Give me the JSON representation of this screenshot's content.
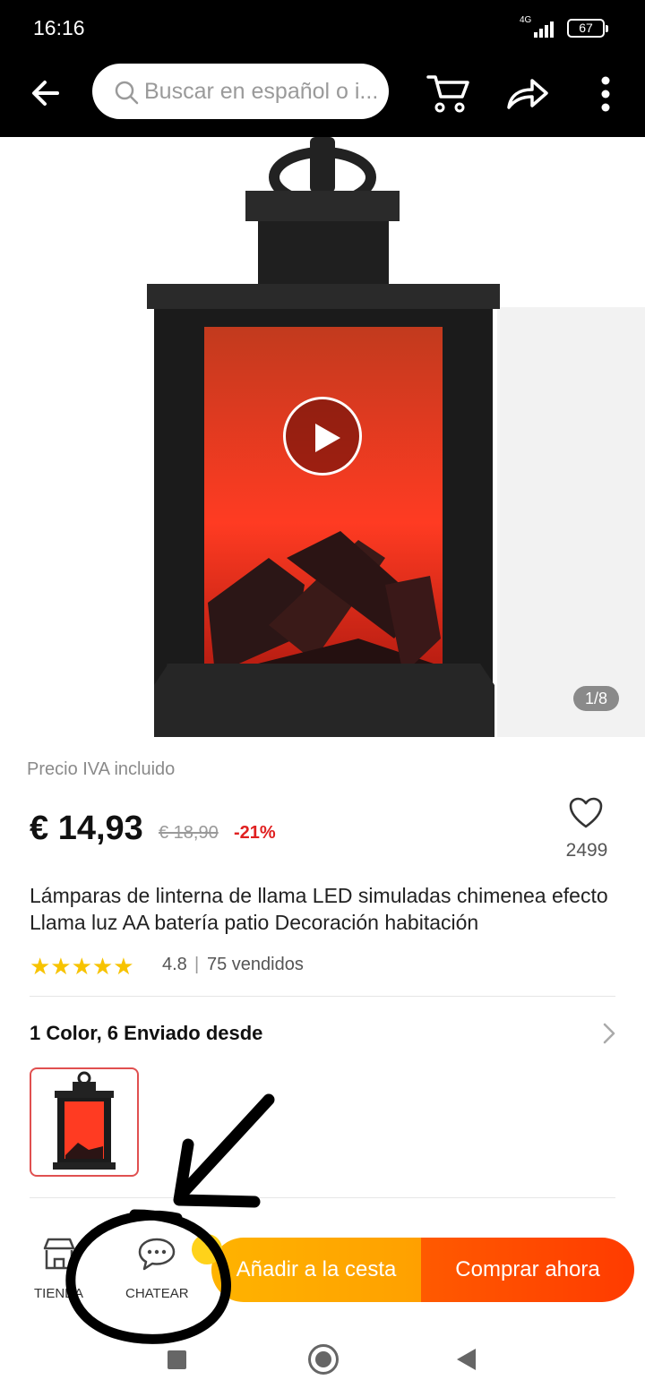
{
  "status_bar": {
    "time": "16:16",
    "network": "4G",
    "battery": "67"
  },
  "search": {
    "placeholder": "Buscar en español o i..."
  },
  "gallery": {
    "counter": "1/8"
  },
  "product": {
    "vat_note": "Precio IVA incluido",
    "price": "€ 14,93",
    "old_price": "€ 18,90",
    "discount": "-21%",
    "wishlist_count": "2499",
    "title": "Lámparas de linterna de llama LED simuladas chimenea efecto Llama luz AA batería patio Decoración habitación",
    "rating_stars": "★★★★★",
    "rating": "4.8",
    "rating_separator": "|",
    "sold": "75 vendidos"
  },
  "variants": {
    "title": "1 Color, 6 Enviado desde"
  },
  "bottom_bar": {
    "store_label": "TIENDA",
    "chat_label": "CHATEAR",
    "add_to_cart": "Añadir a la cesta",
    "buy_now": "Comprar ahora"
  },
  "colors": {
    "header_bg": "#000000",
    "add_to_cart": "#ffa500",
    "buy_now": "#ff4b00",
    "discount": "#e02020",
    "star": "#f7c300"
  }
}
